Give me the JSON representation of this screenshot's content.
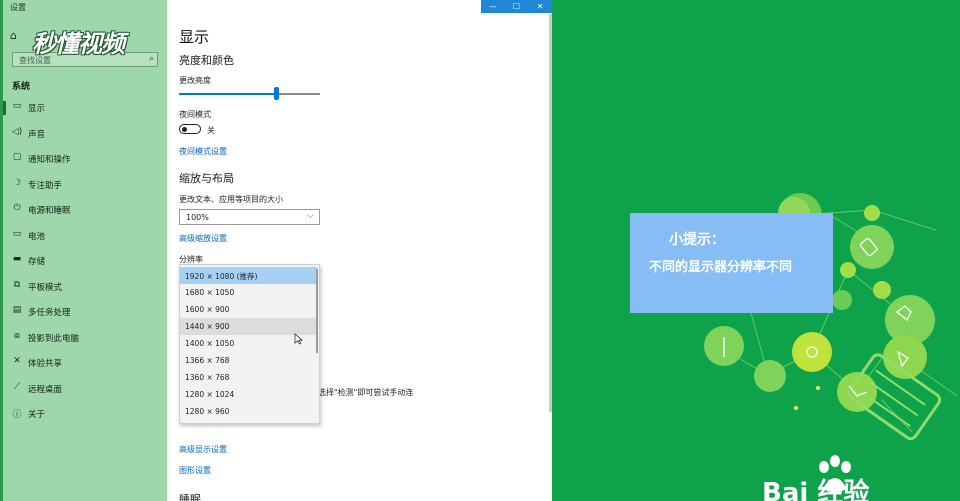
{
  "window": {
    "title": "设置",
    "controls": {
      "minimize": "—",
      "maximize": "☐",
      "close": "✕"
    }
  },
  "watermark": {
    "text": "秒懂视频"
  },
  "sidebar": {
    "search_placeholder": "查找设置",
    "section_label": "系统",
    "items": [
      {
        "label": "显示",
        "icon": "monitor-icon",
        "glyph": "▭",
        "active": true
      },
      {
        "label": "声音",
        "icon": "speaker-icon",
        "glyph": "◁)",
        "active": false
      },
      {
        "label": "通知和操作",
        "icon": "notification-icon",
        "glyph": "▢",
        "active": false
      },
      {
        "label": "专注助手",
        "icon": "moon-icon",
        "glyph": "☽",
        "active": false
      },
      {
        "label": "电源和睡眠",
        "icon": "power-icon",
        "glyph": "⏻",
        "active": false
      },
      {
        "label": "电池",
        "icon": "battery-icon",
        "glyph": "▭",
        "active": false
      },
      {
        "label": "存储",
        "icon": "storage-icon",
        "glyph": "▬",
        "active": false
      },
      {
        "label": "平板模式",
        "icon": "tablet-icon",
        "glyph": "⧉",
        "active": false
      },
      {
        "label": "多任务处理",
        "icon": "multitask-icon",
        "glyph": "▤",
        "active": false
      },
      {
        "label": "投影到此电脑",
        "icon": "project-icon",
        "glyph": "⧈",
        "active": false
      },
      {
        "label": "体验共享",
        "icon": "share-icon",
        "glyph": "✕",
        "active": false
      },
      {
        "label": "远程桌面",
        "icon": "remote-icon",
        "glyph": "⟋",
        "active": false
      },
      {
        "label": "关于",
        "icon": "info-icon",
        "glyph": "ⓘ",
        "active": false
      }
    ]
  },
  "main": {
    "page_title": "显示",
    "brightness_heading": "亮度和颜色",
    "brightness_label": "更改亮度",
    "brightness_level": 0.69,
    "night_mode_label": "夜间模式",
    "night_mode_state": "关",
    "night_mode_link": "夜间模式设置",
    "scale_heading": "缩放与布局",
    "scale_label": "更改文本、应用等项目的大小",
    "scale_value": "100%",
    "advanced_scale_link": "高级缩放设置",
    "resolution_label": "分辨率",
    "resolution_options": [
      "1920 × 1080 (推荐)",
      "1680 × 1050",
      "1600 × 900",
      "1440 × 900",
      "1400 × 1050",
      "1366 × 768",
      "1360 × 768",
      "1280 × 1024",
      "1280 × 960"
    ],
    "selected_option_index": 0,
    "hover_option_index": 3,
    "detect_hint": "选择\"检测\"即可尝试手动连",
    "advanced_display_link": "高级显示设置",
    "graphics_link": "图形设置",
    "bottom_heading": "睡眠"
  },
  "tip": {
    "title": "小提示：",
    "text": "不同的显示器分辨率不同"
  },
  "logo": {
    "text": "Bai  经验"
  },
  "colors": {
    "sidebar": "#9ed7a9",
    "accent": "#0078d7",
    "link": "#0067c0",
    "panel_green": "#0ea24a",
    "tip_box": "#86bdf5"
  }
}
